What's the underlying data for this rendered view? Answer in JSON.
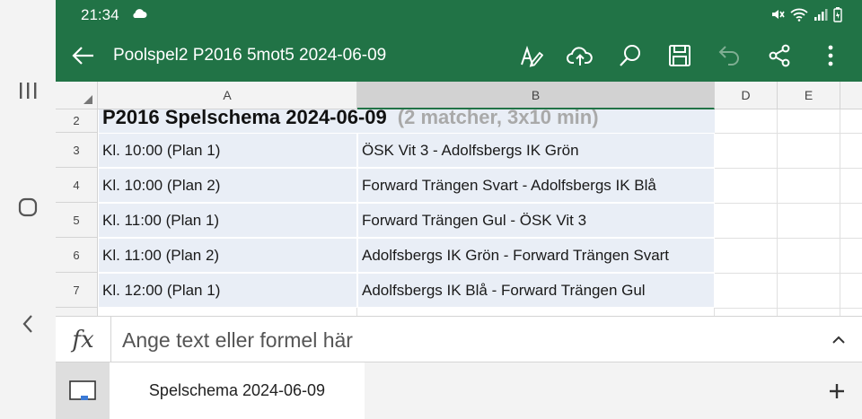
{
  "status": {
    "time": "21:34",
    "icons": [
      "cloud-icon",
      "mute-icon",
      "wifi-icon",
      "signal-icon",
      "battery-icon"
    ]
  },
  "appbar": {
    "title": "Poolspel2 P2016 5mot5 2024-06-09",
    "actions": [
      "draw-icon",
      "cloud-upload-icon",
      "search-icon",
      "save-icon",
      "undo-icon",
      "share-icon",
      "more-icon"
    ]
  },
  "sheet": {
    "columns": [
      "A",
      "B",
      "D",
      "E"
    ],
    "selected_column": "B",
    "rows": [
      {
        "num": "2",
        "a": "P2016 Spelschema 2024-06-09",
        "b": "(2 matcher, 3x10 min)"
      },
      {
        "num": "3",
        "a": "Kl. 10:00 (Plan 1)",
        "b": "ÖSK Vit 3 - Adolfsbergs IK Grön"
      },
      {
        "num": "4",
        "a": "Kl. 10:00 (Plan 2)",
        "b": "Forward Trängen Svart - Adolfsbergs IK Blå"
      },
      {
        "num": "5",
        "a": "Kl. 11:00 (Plan 1)",
        "b": "Forward Trängen Gul - ÖSK Vit 3"
      },
      {
        "num": "6",
        "a": "Kl. 11:00 (Plan 2)",
        "b": "Adolfsbergs IK Grön - Forward Trängen Svart"
      },
      {
        "num": "7",
        "a": "Kl. 12:00 (Plan 1)",
        "b": "Adolfsbergs IK Blå - Forward Trängen Gul"
      }
    ]
  },
  "formula": {
    "fx_label": "fx",
    "placeholder": "Ange text eller formel här",
    "value": ""
  },
  "tabs": {
    "active_sheet": "Spelschema 2024-06-09",
    "add_label": "+"
  },
  "colors": {
    "excel_green": "#217346",
    "cell_fill": "#e9eef6",
    "header_bg": "#f3f3f3"
  }
}
